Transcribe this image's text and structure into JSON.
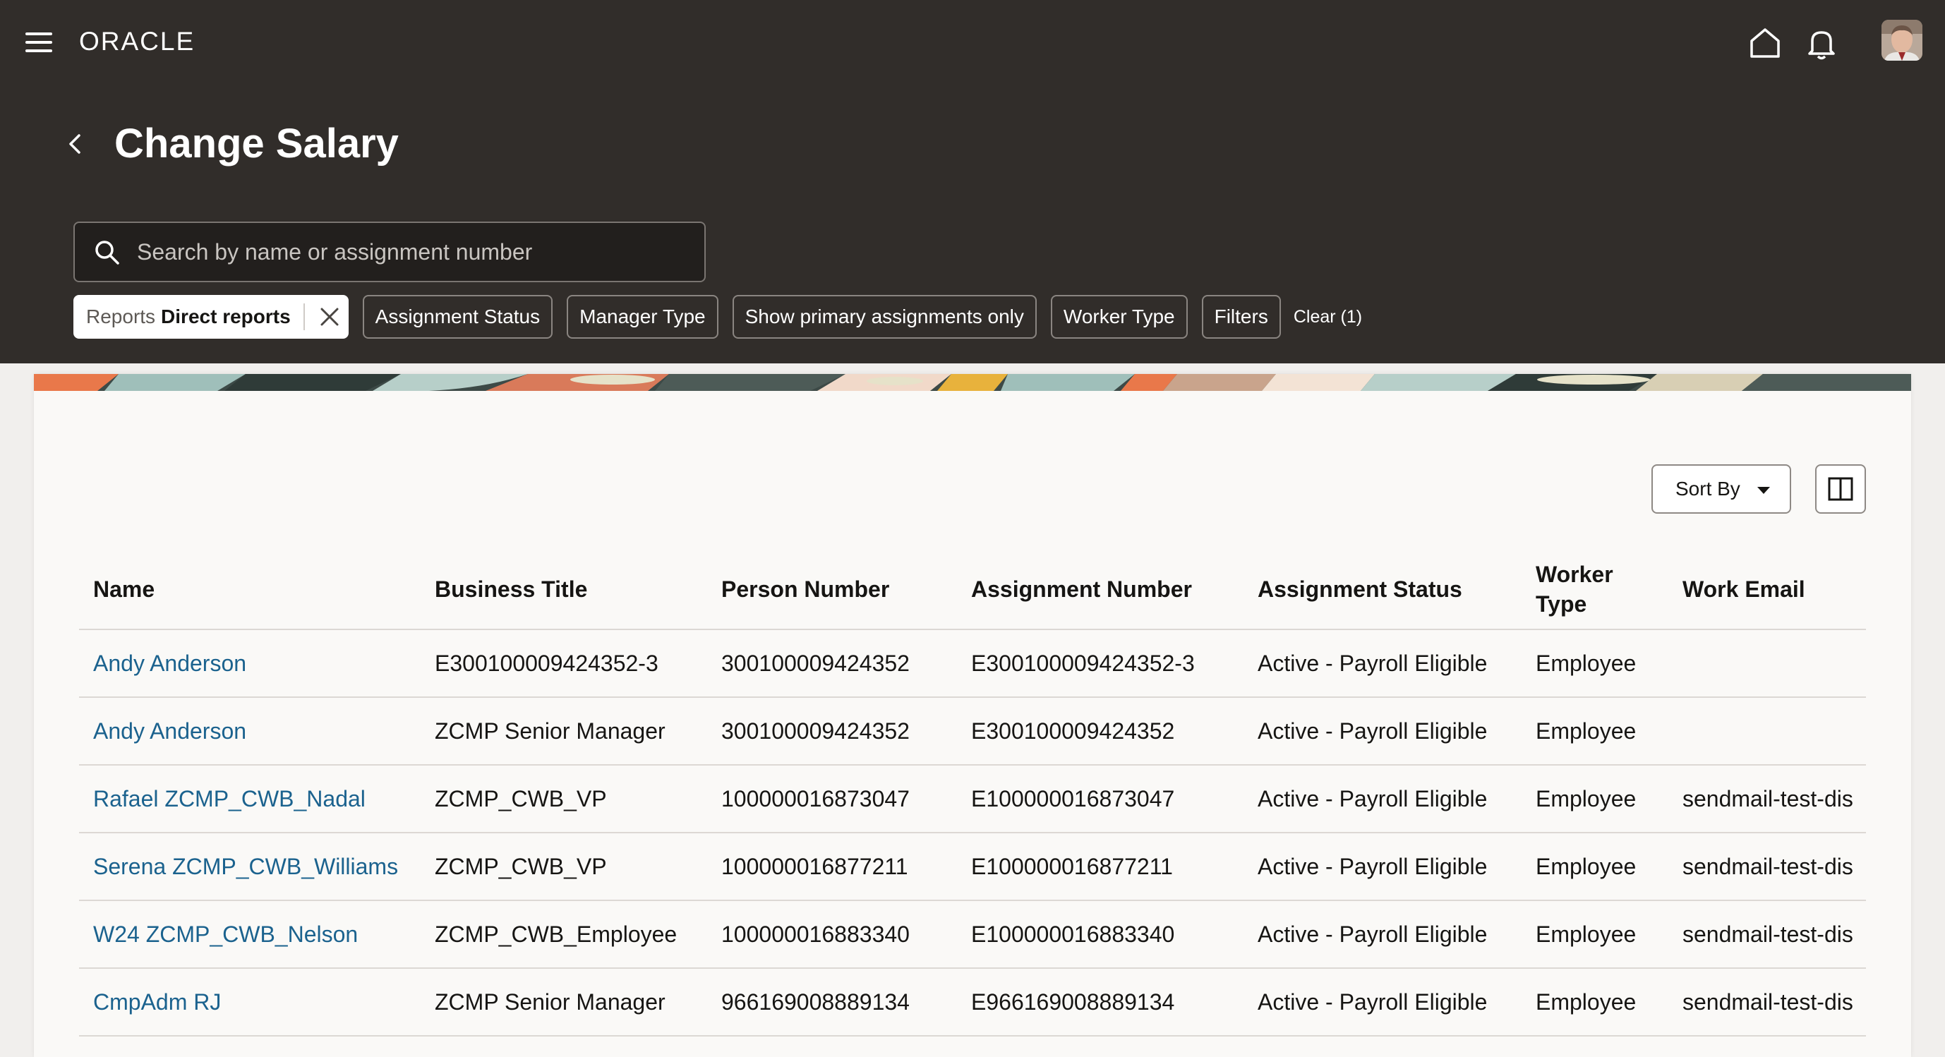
{
  "header": {
    "logo_text": "ORACLE",
    "page_title": "Change Salary",
    "search_placeholder": "Search by name or assignment number"
  },
  "filters": {
    "active_chip": {
      "label": "Reports",
      "value": "Direct reports"
    },
    "chips": [
      "Assignment Status",
      "Manager Type",
      "Show primary assignments only",
      "Worker Type",
      "Filters"
    ],
    "clear_label": "Clear (1)"
  },
  "toolbar": {
    "sort_label": "Sort By"
  },
  "table": {
    "columns": [
      "Name",
      "Business Title",
      "Person Number",
      "Assignment Number",
      "Assignment Status",
      "Worker Type",
      "Work Email"
    ],
    "rows": [
      [
        "Andy Anderson",
        "E300100009424352-3",
        "300100009424352",
        "E300100009424352-3",
        "Active - Payroll Eligible",
        "Employee",
        ""
      ],
      [
        "Andy Anderson",
        "ZCMP Senior Manager",
        "300100009424352",
        "E300100009424352",
        "Active - Payroll Eligible",
        "Employee",
        ""
      ],
      [
        "Rafael ZCMP_CWB_Nadal",
        "ZCMP_CWB_VP",
        "100000016873047",
        "E100000016873047",
        "Active - Payroll Eligible",
        "Employee",
        "sendmail-test-dis"
      ],
      [
        "Serena ZCMP_CWB_Williams",
        "ZCMP_CWB_VP",
        "100000016877211",
        "E100000016877211",
        "Active - Payroll Eligible",
        "Employee",
        "sendmail-test-dis"
      ],
      [
        "W24 ZCMP_CWB_Nelson",
        "ZCMP_CWB_Employee",
        "100000016883340",
        "E100000016883340",
        "Active - Payroll Eligible",
        "Employee",
        "sendmail-test-dis"
      ],
      [
        "CmpAdm RJ",
        "ZCMP Senior Manager",
        "966169008889134",
        "E966169008889134",
        "Active - Payroll Eligible",
        "Employee",
        "sendmail-test-dis"
      ]
    ]
  },
  "colors": {
    "header_bg": "#312d2a",
    "link": "#1b628e",
    "card_bg": "#faf9f7"
  },
  "icons": [
    "hamburger-menu-icon",
    "home-icon",
    "bell-icon",
    "back-chevron-icon",
    "search-icon",
    "close-icon",
    "caret-down-icon",
    "columns-icon"
  ]
}
